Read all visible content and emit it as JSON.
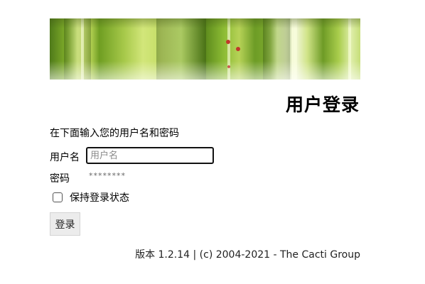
{
  "login": {
    "title": "用户登录",
    "instructions": "在下面输入您的用户名和密码",
    "username_label": "用户名",
    "username_placeholder": "用户名",
    "username_value": "",
    "password_label": "密码",
    "password_value": "********",
    "remember_label": "保持登录状态",
    "remember_checked": false,
    "submit_label": "登录"
  },
  "footer": {
    "version_text": "版本 1.2.14 | (c) 2004-2021 - The Cacti Group"
  },
  "colors": {
    "banner_green": "#86b42c",
    "thorn_red": "#c0392b",
    "button_bg": "#ececec"
  }
}
